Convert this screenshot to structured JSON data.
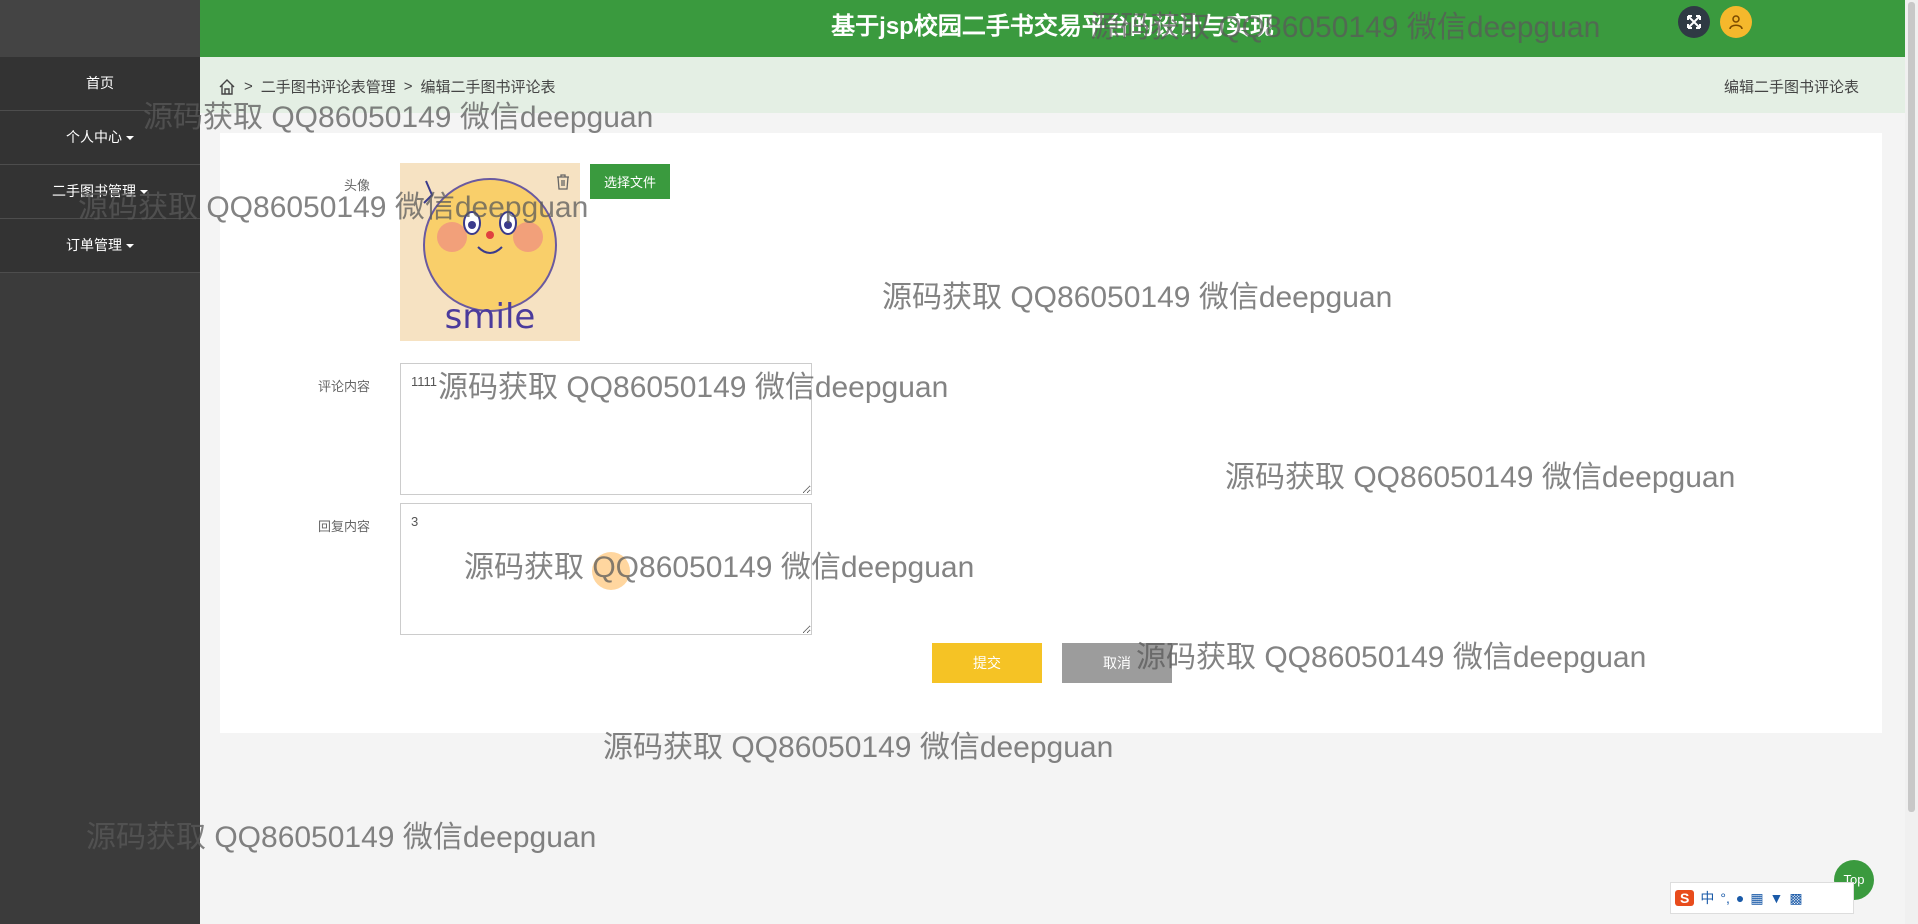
{
  "header": {
    "title": "基于jsp校园二手书交易平台的设计与实现"
  },
  "sidebar": {
    "items": [
      {
        "label": "首页"
      },
      {
        "label": "个人中心"
      },
      {
        "label": "二手图书管理"
      },
      {
        "label": "订单管理"
      }
    ]
  },
  "breadcrumb": {
    "items": [
      "二手图书评论表管理",
      "编辑二手图书评论表"
    ],
    "separator": ">",
    "right_title": "编辑二手图书评论表"
  },
  "form": {
    "avatar_label": "头像",
    "choose_file_label": "选择文件",
    "avatar_image_text": "smile",
    "comment_label": "评论内容",
    "comment_value": "1111",
    "reply_label": "回复内容",
    "reply_value": "3",
    "submit_label": "提交",
    "cancel_label": "取消"
  },
  "watermark_text": "源码获取 QQ86050149 微信deepguan",
  "top_button_label": "Top",
  "ime": {
    "logo": "S",
    "lang": "中"
  },
  "colors": {
    "header_green": "#3a9a3e",
    "sidebar_dark": "#333333",
    "submit_yellow": "#f5c325",
    "cancel_gray": "#9c9c9c",
    "crumb_bg": "#e4efe4"
  }
}
